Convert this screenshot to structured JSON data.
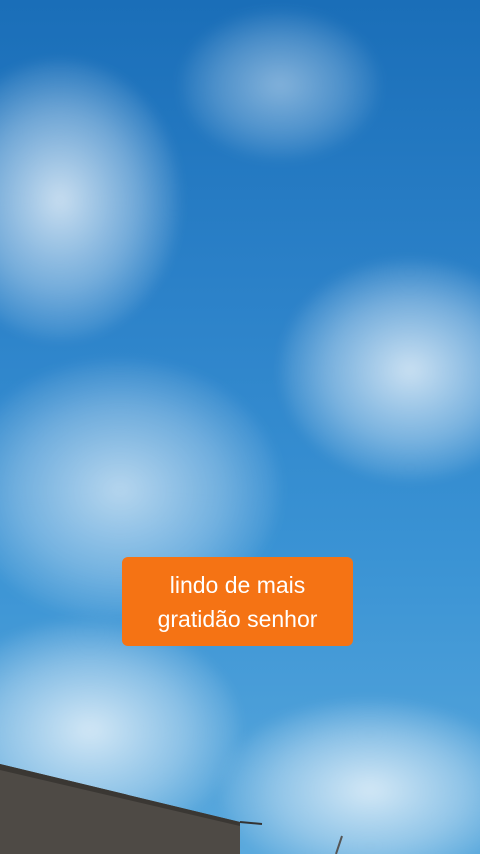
{
  "caption": {
    "line1": "lindo de mais",
    "line2": "gratidão senhor"
  },
  "colors": {
    "sky_top": "#1a6eb8",
    "sky_bottom": "#5aa9dd",
    "caption_background": "#f57314",
    "caption_text": "#ffffff",
    "wall": "#4e4a45"
  }
}
